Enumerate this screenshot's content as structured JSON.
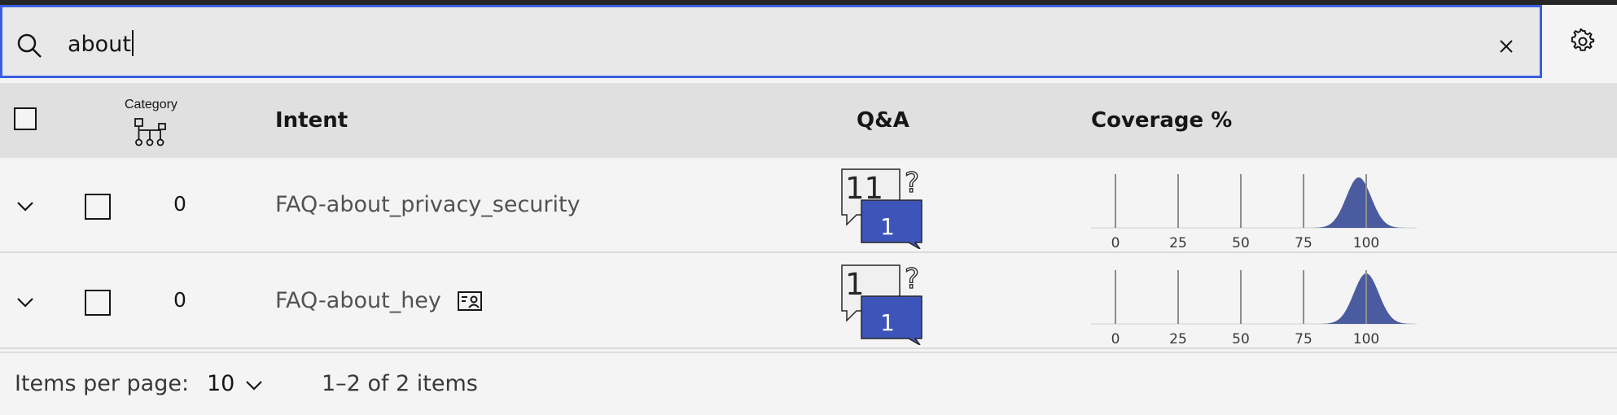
{
  "search": {
    "value": "about"
  },
  "table": {
    "headers": {
      "category": "Category",
      "intent": "Intent",
      "qa": "Q&A",
      "coverage": "Coverage %"
    },
    "coverage_ticks": [
      "0",
      "25",
      "50",
      "75",
      "100"
    ],
    "rows": [
      {
        "count": "0",
        "intent": "FAQ-about_privacy_security",
        "qa_examples": "11",
        "qa_answers": "1",
        "coverage_peak": 97,
        "has_content_icon": false
      },
      {
        "count": "0",
        "intent": "FAQ-about_hey",
        "qa_examples": "1",
        "qa_answers": "1",
        "coverage_peak": 100,
        "has_content_icon": true
      }
    ]
  },
  "pagination": {
    "items_per_page_label": "Items per page:",
    "items_per_page_value": "10",
    "range_text": "1–2 of 2 items"
  },
  "colors": {
    "accent": "#3b5fe0",
    "qa_blue": "#3d55b8",
    "coverage_fill": "#4a5c9f"
  },
  "icons": [
    "search-icon",
    "close-icon",
    "gear-icon",
    "category-tree-icon",
    "chevron-down-icon",
    "contact-card-icon"
  ]
}
